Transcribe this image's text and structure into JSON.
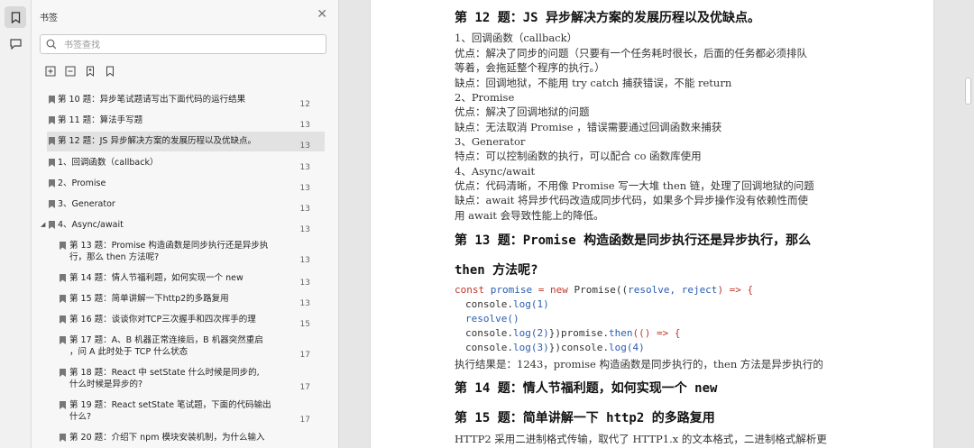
{
  "sidebar": {
    "title": "书签",
    "search_placeholder": "书签查找",
    "items": [
      {
        "label": "第 10 题：异步笔试题请写出下面代码的运行结果",
        "page": "12"
      },
      {
        "label": "第 11 题：算法手写题",
        "page": "13"
      },
      {
        "label": "第 12 题：JS 异步解决方案的发展历程以及优缺点。",
        "page": "13"
      },
      {
        "label": "1、回调函数（callback）",
        "page": "13"
      },
      {
        "label": "2、Promise",
        "page": "13"
      },
      {
        "label": "3、Generator",
        "page": "13"
      },
      {
        "label": "4、Async/await",
        "page": "13"
      },
      {
        "label1": "第 13 题：Promise 构造函数是同步执行还是异步执",
        "label2": "行，那么 then 方法呢?",
        "page": "13"
      },
      {
        "label": "第 14 题：情人节福利题，如何实现一个 new",
        "page": "13"
      },
      {
        "label": "第 15 题：简单讲解一下http2的多路复用",
        "page": "13"
      },
      {
        "label": "第 16 题：谈谈你对TCP三次握手和四次挥手的理",
        "page": "15"
      },
      {
        "label1": "第 17 题：A、B 机器正常连接后，B 机器突然重启",
        "label2": "，问 A 此时处于 TCP 什么状态",
        "page": "17"
      },
      {
        "label1": "第 18 题：React 中 setState 什么时候是同步的,",
        "label2": "什么时候是异步的?",
        "page": "17"
      },
      {
        "label1": "第 19 题：React setState 笔试题，下面的代码输出",
        "label2": "什么?",
        "page": "17"
      },
      {
        "label1": "第 20 题：介绍下 npm 模块安装机制，为什么输入",
        "label2": "",
        "page": ""
      }
    ]
  },
  "doc": {
    "h12": "第 12 题：JS 异步解决方案的发展历程以及优缺点。",
    "l1": "1、回调函数（callback）",
    "l2": "优点：解决了同步的问题（只要有一个任务耗时很长，后面的任务都必须排队",
    "l3": "等着，会拖延整个程序的执行。）",
    "l4": "缺点：回调地狱，不能用 try catch 捕获错误，不能 return",
    "l5": "2、Promise",
    "l6": "优点：解决了回调地狱的问题",
    "l7": "缺点：无法取消 Promise ，错误需要通过回调函数来捕获",
    "l8": "3、Generator",
    "l9": "特点：可以控制函数的执行，可以配合 co 函数库使用",
    "l10": "4、Async/await",
    "l11": "优点：代码清晰，不用像 Promise 写一大堆 then 链，处理了回调地狱的问题",
    "l12": "缺点：await 将异步代码改造成同步代码，如果多个异步操作没有依赖性而使",
    "l13": "用 await 会导致性能上的降低。",
    "h13a": "第 13 题：Promise 构造函数是同步执行还是异步执行，那么",
    "h13b": "then 方法呢?",
    "code1_kw": "const",
    "code1_var": "promise",
    "code1_eq": " = ",
    "code1_new": "new",
    "code1_cls": " Promise((",
    "code1_args": "resolve, reject",
    "code1_end": ") => {",
    "code2_pre": "console.",
    "code2_fn": "log(1)",
    "code3": "resolve()",
    "code4_pre": "console.",
    "code4_fn": "log(2)",
    "code4_mid": "})promise.",
    "code4_then": "then",
    "code4_end": "(() => {",
    "code5_pre": "console.",
    "code5_fn": "log(3)",
    "code5_mid": "})console.",
    "code5_fn2": "log(4)",
    "result": "执行结果是：1243，promise 构造函数是同步执行的，then 方法是异步执行的",
    "h14": "第 14 题：情人节福利题，如何实现一个 new",
    "h15": "第 15 题：简单讲解一下 http2 的多路复用",
    "l_http2": "HTTP2 采用二进制格式传输，取代了 HTTP1.x 的文本格式，二进制格式解析更"
  },
  "colors": {
    "keyword": "#c0392b",
    "identifier": "#2a5db0",
    "selected_row": "#e2e2e2"
  }
}
